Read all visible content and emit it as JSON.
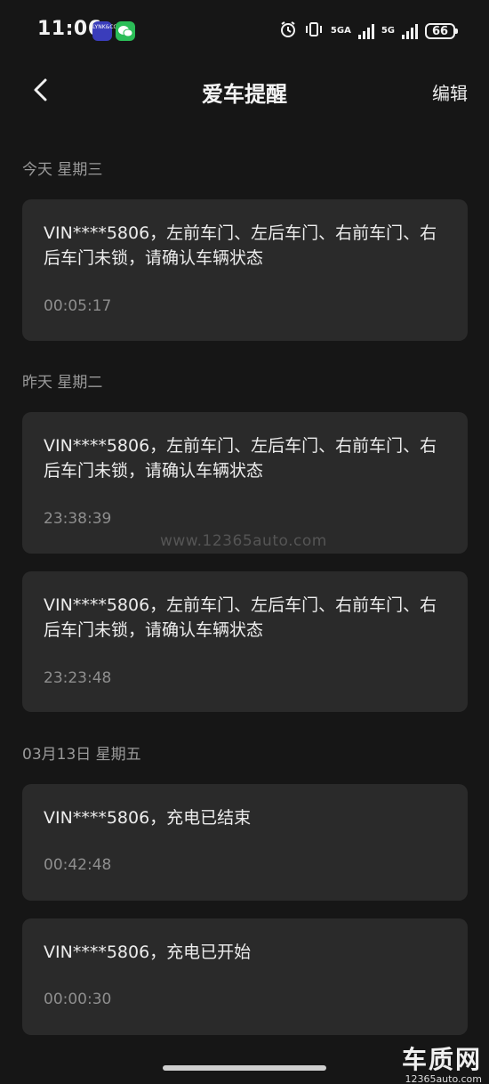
{
  "status_bar": {
    "time": "11:06",
    "app1_label": "LYNK&CO",
    "net1": "5GA",
    "net2": "5G",
    "battery": "66"
  },
  "header": {
    "title": "爱车提醒",
    "edit_label": "编辑"
  },
  "sections": [
    {
      "label": "今天 星期三",
      "items": [
        {
          "message": "VIN****5806，左前车门、左后车门、右前车门、右后车门未锁，请确认车辆状态",
          "time": "00:05:17"
        }
      ]
    },
    {
      "label": "昨天 星期二",
      "items": [
        {
          "message": "VIN****5806，左前车门、左后车门、右前车门、右后车门未锁，请确认车辆状态",
          "time": "23:38:39"
        },
        {
          "message": "VIN****5806，左前车门、左后车门、右前车门、右后车门未锁，请确认车辆状态",
          "time": "23:23:48"
        }
      ]
    },
    {
      "label": "03月13日 星期五",
      "items": [
        {
          "message": "VIN****5806，充电已结束",
          "time": "00:42:48"
        },
        {
          "message": "VIN****5806，充电已开始",
          "time": "00:00:30"
        }
      ]
    }
  ],
  "watermark": "www.12365auto.com",
  "corner_logo": {
    "title": "车质网",
    "url": "12365auto.com"
  },
  "colors": {
    "background": "#161616",
    "card": "#2a2a2a",
    "text": "#ececec",
    "muted": "#8e8e8e"
  }
}
